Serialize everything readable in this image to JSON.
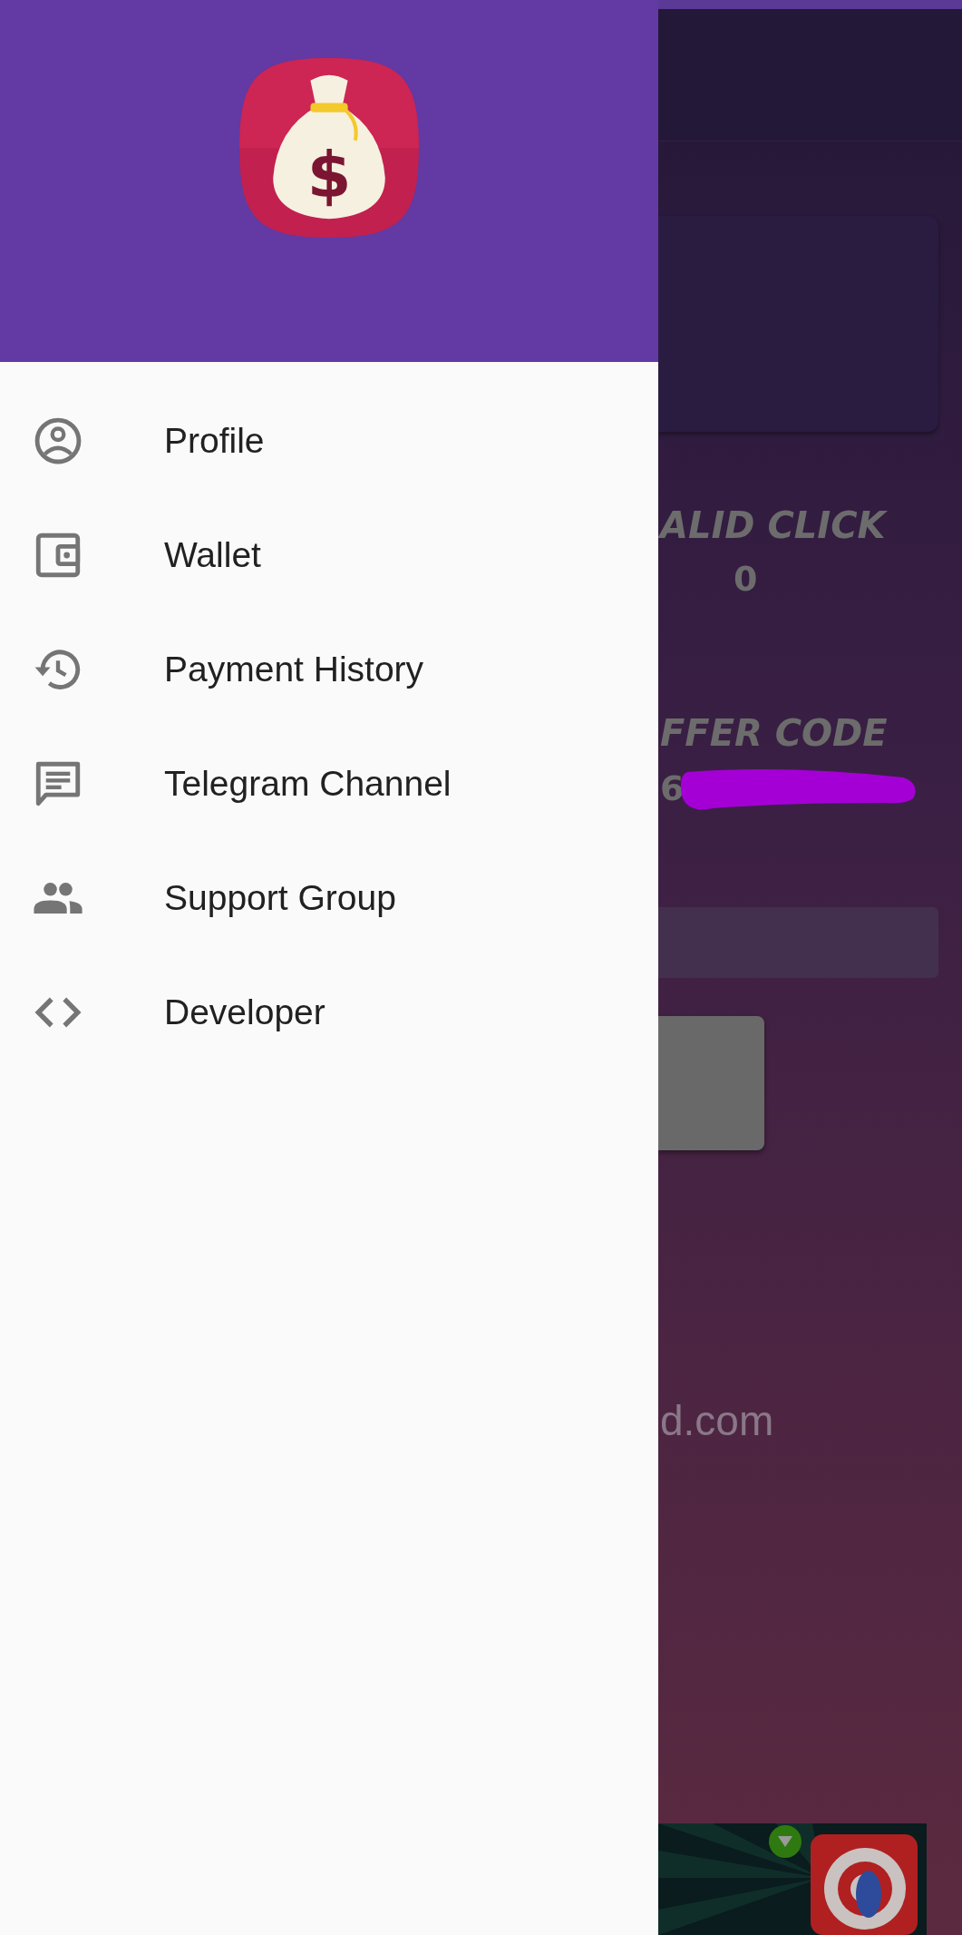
{
  "drawer": {
    "logo_symbol": "$",
    "menu": [
      {
        "label": "Profile",
        "kind": "profile"
      },
      {
        "label": "Wallet",
        "kind": "wallet"
      },
      {
        "label": "Payment History",
        "kind": "history"
      },
      {
        "label": "Telegram Channel",
        "kind": "chat"
      },
      {
        "label": "Support Group",
        "kind": "group"
      },
      {
        "label": "Developer",
        "kind": "code"
      }
    ]
  },
  "background_screen": {
    "stats": [
      {
        "label": "ALID CLICK",
        "value": "0"
      },
      {
        "label": "FFER CODE",
        "value": "6"
      }
    ],
    "footer_text": "d.com"
  }
}
